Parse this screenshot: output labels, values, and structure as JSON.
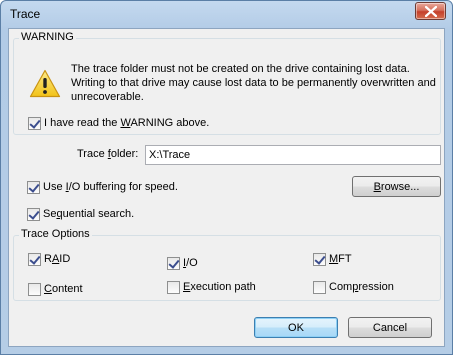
{
  "window": {
    "title": "Trace"
  },
  "warning": {
    "group_label": "WARNING",
    "message": "The trace folder must not be created on the drive containing lost data. Writing to that drive may cause lost data to be permanently overwritten and unrecoverable.",
    "read_checkbox": {
      "pre": "I have read the ",
      "accel": "W",
      "post": "ARNING above.",
      "checked": true
    }
  },
  "trace_folder": {
    "pre": "Trace ",
    "accel": "f",
    "post": "older:",
    "value": "X:\\Trace"
  },
  "io_buffering": {
    "pre": "Use ",
    "accel": "I",
    "post": "/O buffering for speed.",
    "checked": true
  },
  "browse_button": {
    "accel": "B",
    "post": "rowse..."
  },
  "sequential": {
    "pre": "Se",
    "accel": "q",
    "post": "uential search.",
    "checked": true
  },
  "options": {
    "group_label": "Trace Options",
    "raid": {
      "pre": "R",
      "accel": "A",
      "post": "ID",
      "checked": true
    },
    "io": {
      "pre": "",
      "accel": "I",
      "post": "/O",
      "checked": true
    },
    "mft": {
      "pre": "",
      "accel": "M",
      "post": "FT",
      "checked": true
    },
    "content": {
      "pre": "",
      "accel": "C",
      "post": "ontent",
      "checked": false
    },
    "execution_path": {
      "pre": "",
      "accel": "E",
      "post": "xecution path",
      "checked": false
    },
    "compression": {
      "pre": "Com",
      "accel": "p",
      "post": "ression",
      "checked": false
    }
  },
  "ok_button": {
    "label": "OK"
  },
  "cancel_button": {
    "label": "Cancel"
  }
}
